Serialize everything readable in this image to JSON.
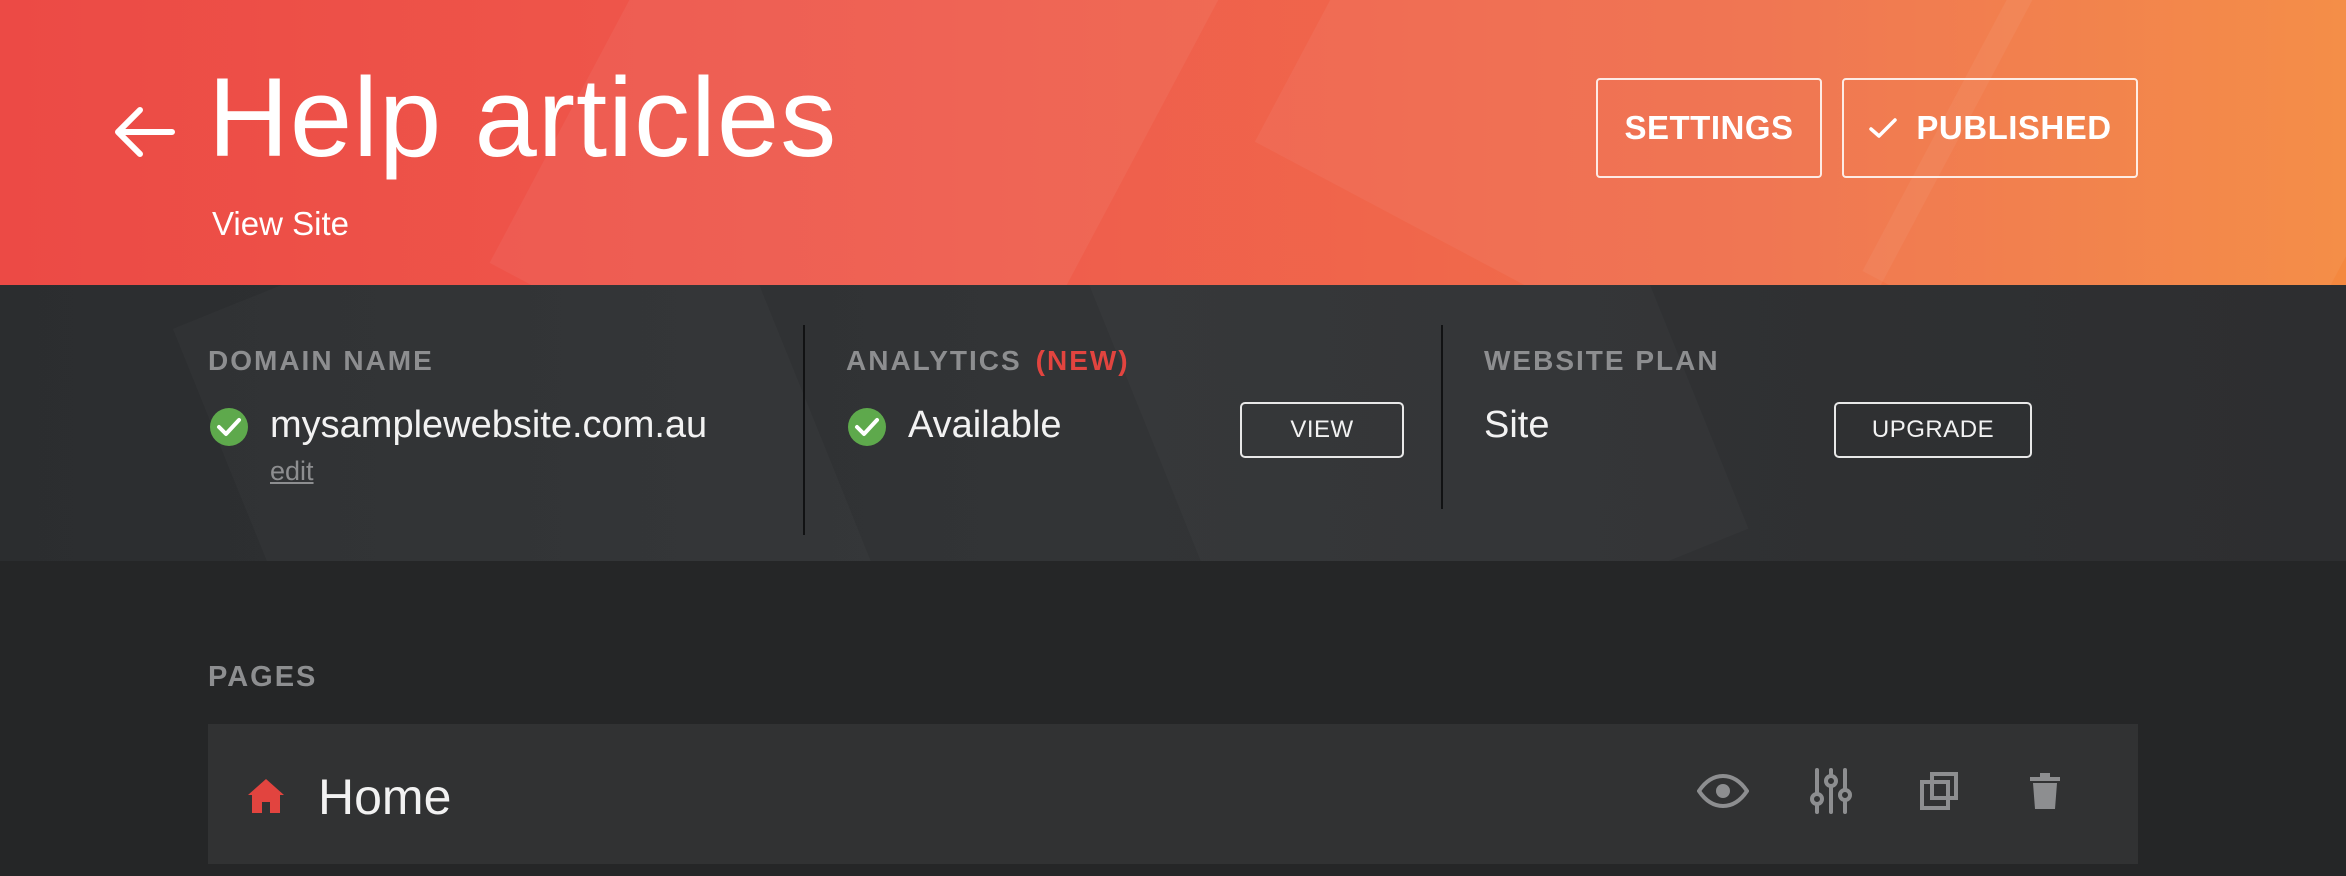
{
  "header": {
    "title": "Help articles",
    "view_site_label": "View Site",
    "settings_label": "SETTINGS",
    "published_label": "PUBLISHED"
  },
  "domain": {
    "label": "DOMAIN NAME",
    "value": "mysamplewebsite.com.au",
    "edit_label": "edit"
  },
  "analytics": {
    "label": "ANALYTICS",
    "new_badge": "(NEW)",
    "value": "Available",
    "view_label": "VIEW"
  },
  "plan": {
    "label": "WEBSITE PLAN",
    "value": "Site",
    "upgrade_label": "UPGRADE"
  },
  "pages": {
    "label": "PAGES",
    "items": [
      {
        "name": "Home",
        "icon": "home-icon"
      }
    ]
  },
  "colors": {
    "accent_red": "#ec4a45",
    "accent_orange": "#f4883f",
    "success_green": "#5ea94c",
    "new_badge": "#e2443f"
  },
  "icons": {
    "back": "arrow-left-icon",
    "published_check": "check-icon",
    "status": "check-circle-icon",
    "row_actions": [
      "eye-icon",
      "sliders-icon",
      "duplicate-icon",
      "trash-icon"
    ]
  }
}
